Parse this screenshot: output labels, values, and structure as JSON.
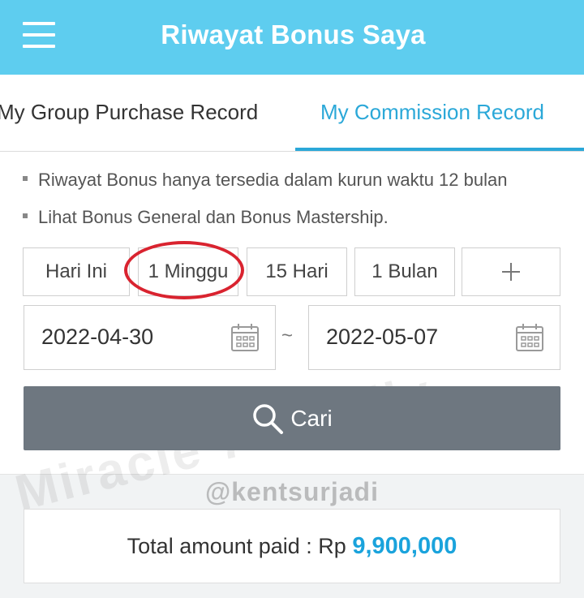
{
  "header": {
    "title": "Riwayat Bonus Saya"
  },
  "tabs": [
    {
      "label": "My Group Purchase Record",
      "active": false
    },
    {
      "label": "My Commission Record",
      "active": true
    }
  ],
  "notes": [
    "Riwayat Bonus hanya tersedia dalam kurun waktu 12 bulan",
    "Lihat Bonus General dan Bonus Mastership."
  ],
  "period_buttons": [
    "Hari Ini",
    "1 Minggu",
    "15 Hari",
    "1 Bulan"
  ],
  "more_button": {
    "icon": "plus-icon"
  },
  "date_range": {
    "from": "2022-04-30",
    "separator": "~",
    "to": "2022-05-07",
    "icon": "calendar-icon"
  },
  "search": {
    "label": "Cari",
    "icon": "search-icon"
  },
  "watermark": "Miracle 7 Family",
  "handle": "@kentsurjadi",
  "total": {
    "label": "Total amount paid : Rp ",
    "amount": "9,900,000"
  },
  "colors": {
    "header": "#5ecdef",
    "accent": "#2ba8d8",
    "search_button": "#6e7780",
    "highlight_ring": "#d9232f",
    "amount": "#1aa3dc"
  }
}
